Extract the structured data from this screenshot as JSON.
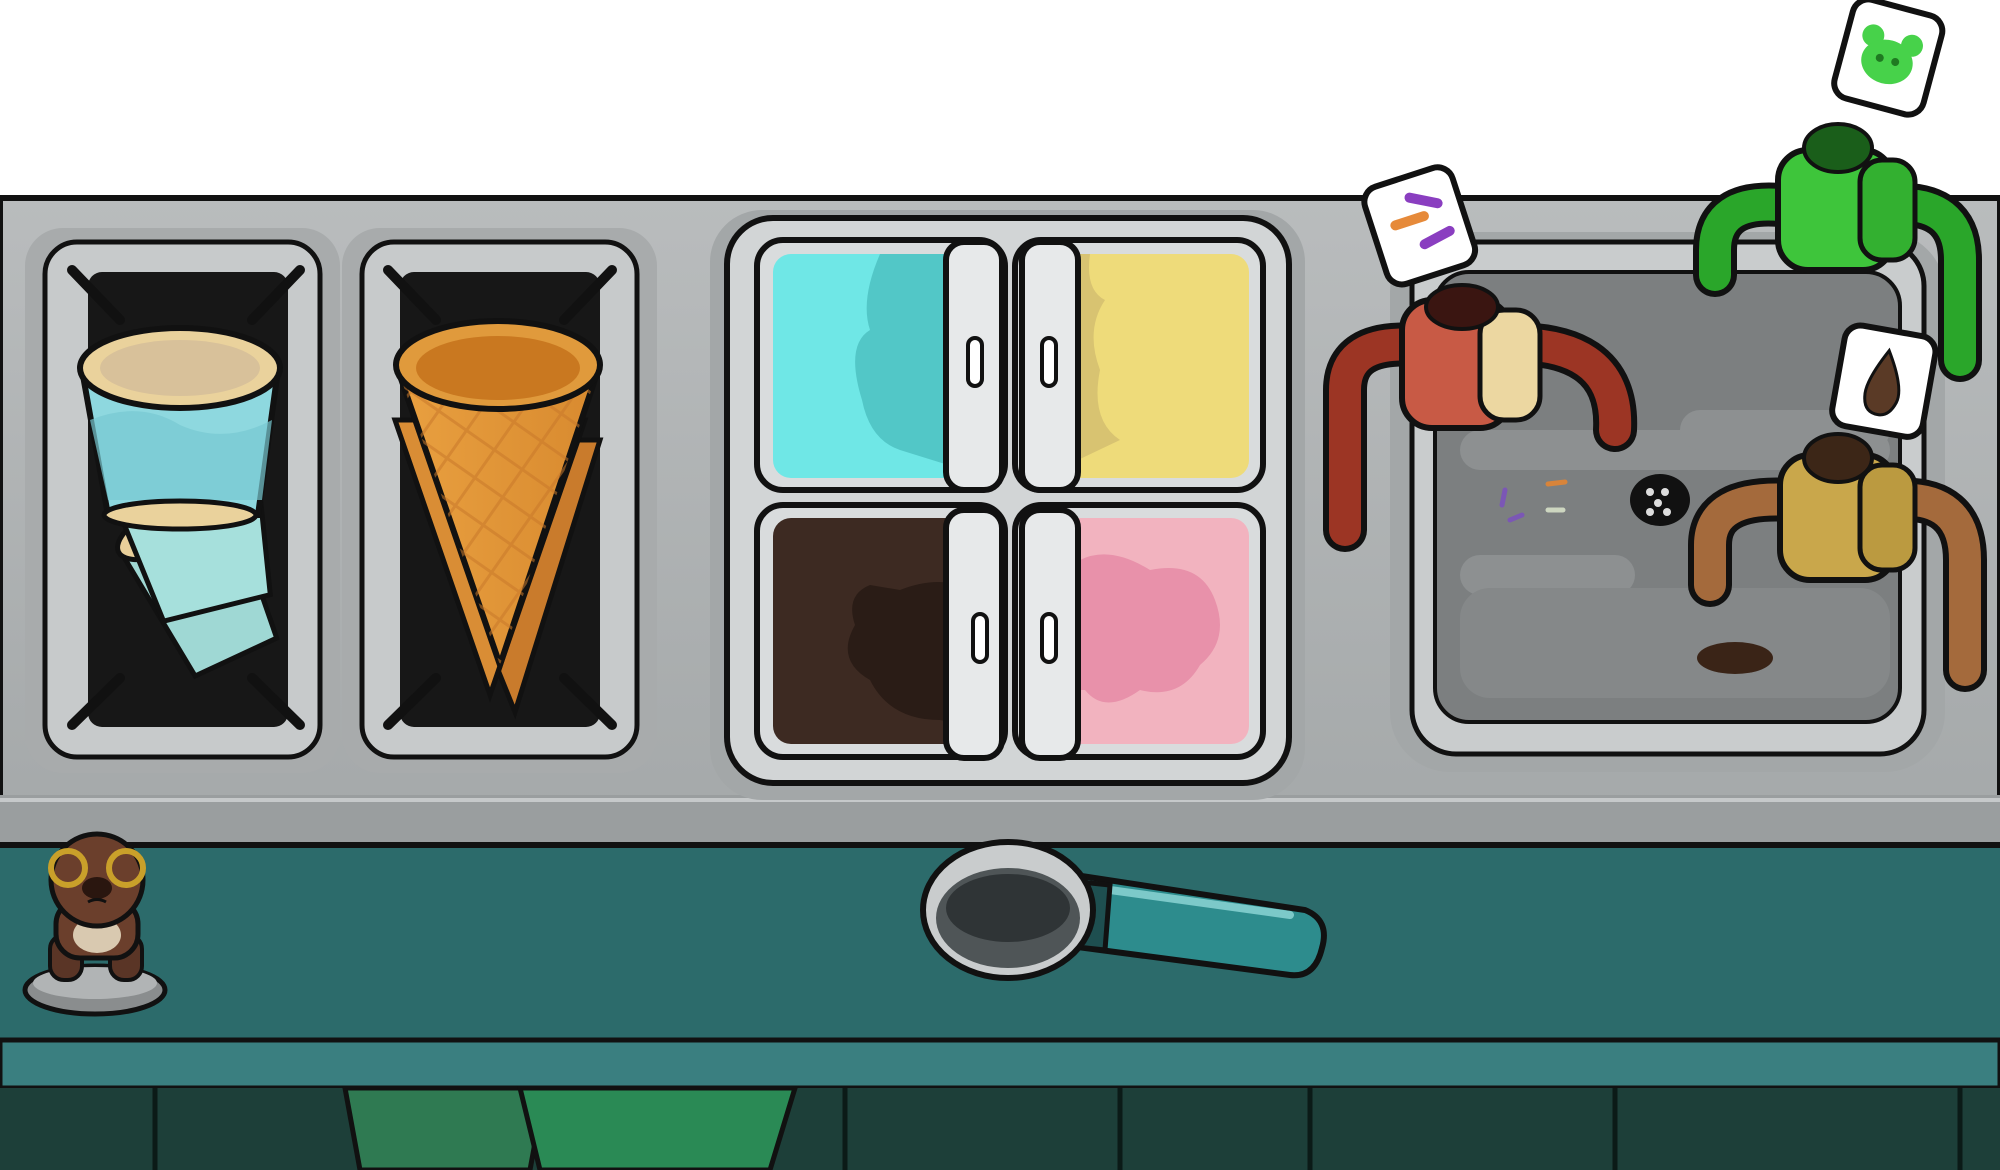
{
  "game": {
    "scene": "ice-cream-counter",
    "containers": [
      {
        "kind": "cup",
        "icon": "cup-stack-icon"
      },
      {
        "kind": "cone",
        "icon": "waffle-cone-stack-icon"
      }
    ],
    "flavors": [
      {
        "name": "mint",
        "color": "#6fe7e6"
      },
      {
        "name": "vanilla",
        "color": "#eedb7a"
      },
      {
        "name": "chocolate",
        "color": "#3d2a22"
      },
      {
        "name": "strawberry",
        "color": "#f2b3bf"
      }
    ],
    "dispensers": [
      {
        "kind": "sprinkles",
        "icon": "sprinkles-icon",
        "color": "#c85a45"
      },
      {
        "kind": "gummy-bear",
        "icon": "gummy-bear-icon",
        "color": "#3ec53b"
      },
      {
        "kind": "chocolate-chips",
        "icon": "chocolate-chip-icon",
        "color": "#c9a74b"
      }
    ],
    "tools": [
      {
        "kind": "ice-cream-scoop",
        "icon": "scoop-icon",
        "color": "#2d8c8d"
      }
    ],
    "decor": [
      {
        "kind": "bear-figurine",
        "icon": "bear-figurine-icon"
      }
    ]
  }
}
